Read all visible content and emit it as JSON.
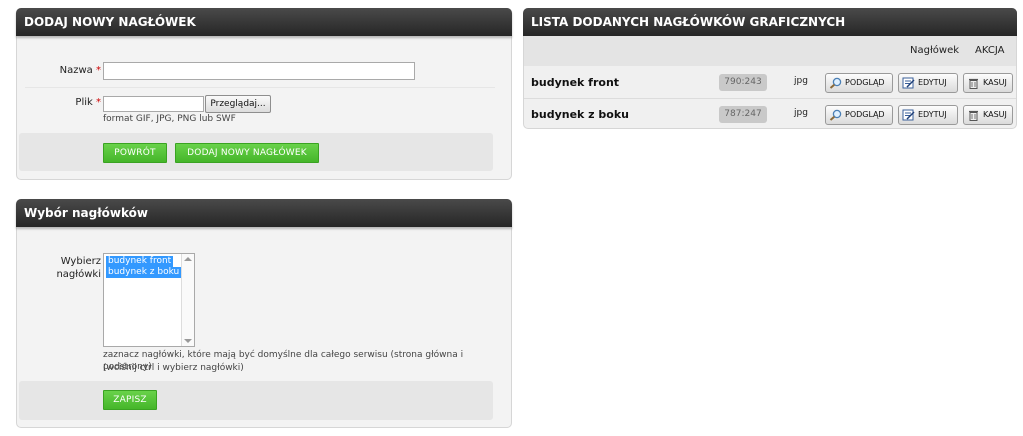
{
  "add_panel": {
    "title": "DODAJ NOWY NAGŁÓWEK",
    "name_label": "Nazwa",
    "name_value": "",
    "file_label": "Plik",
    "browse_label": "Przeglądaj...",
    "format_hint": "format GIF, JPG, PNG lub SWF",
    "back_label": "POWRÓT",
    "add_label": "DODAJ NOWY NAGŁÓWEK",
    "required_mark": "*"
  },
  "select_panel": {
    "title": "Wybór nagłówków",
    "label_line1": "Wybierz",
    "label_line2": "nagłówki",
    "options": [
      "budynek front",
      "budynek z boku"
    ],
    "hint_line1": "zaznacz nagłówki, które mają być domyślne dla całego serwisu (strona główna i podstrony)",
    "hint_line2": "(wciśnij ctrl i wybierz nagłówki)",
    "save_label": "ZAPISZ"
  },
  "list_panel": {
    "title": "LISTA DODANYCH NAGŁÓWKÓW GRAFICZNYCH",
    "col_header": "Nagłówek",
    "col_actions": "AKCJA",
    "rows": [
      {
        "name": "budynek front",
        "dims": "790:243",
        "ext": "jpg"
      },
      {
        "name": "budynek z boku",
        "dims": "787:247",
        "ext": "jpg"
      }
    ],
    "preview_label": "PODGLĄD",
    "edit_label": "EDYTUJ",
    "delete_label": "KASUJ"
  },
  "colors": {
    "header_dark": "#2e2e2e",
    "accent_green": "#55c33a",
    "required_red": "#cc0000",
    "selection_blue": "#3399ff"
  }
}
